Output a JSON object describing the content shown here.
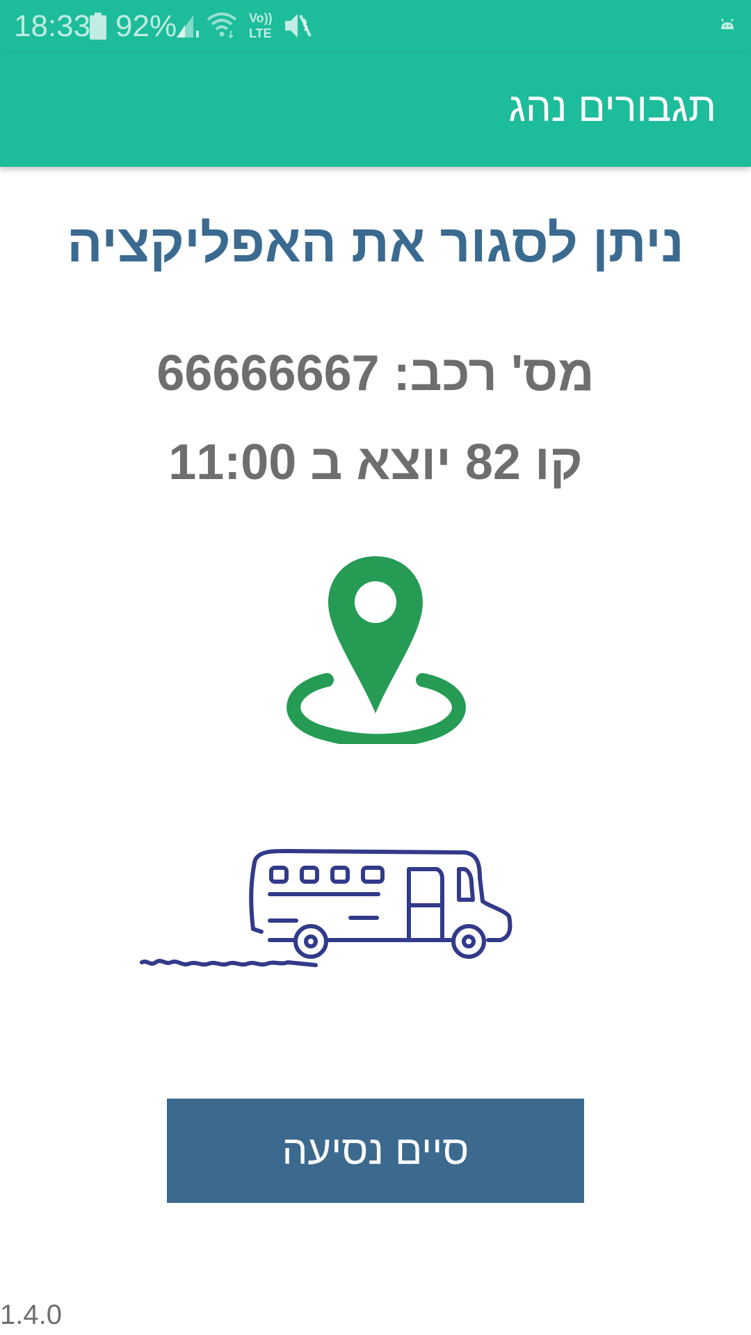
{
  "status_bar": {
    "time": "18:33",
    "battery_percent": "92%",
    "battery_level": 0.92,
    "icons": [
      "battery-icon",
      "signal-icon",
      "wifi-icon",
      "volte-icon",
      "mute-icon",
      "android-icon"
    ],
    "volte_text_top": "Vo))",
    "volte_text_bottom": "LTE"
  },
  "app_bar": {
    "title": "תגבורים נהג"
  },
  "main": {
    "headline": "ניתן לסגור את האפליקציה",
    "vehicle_line": "מס' רכב: 66666667",
    "route_line": "קו 82 יוצא ב 11:00"
  },
  "actions": {
    "end_trip_label": "סיים נסיעה"
  },
  "footer": {
    "version": "1.4.0"
  },
  "colors": {
    "app_bar": "#1dbc9a",
    "headline": "#3b6a90",
    "body_text": "#6e6e6e",
    "pin": "#259b54",
    "bus": "#323a8a",
    "button": "#3c6a8f"
  }
}
